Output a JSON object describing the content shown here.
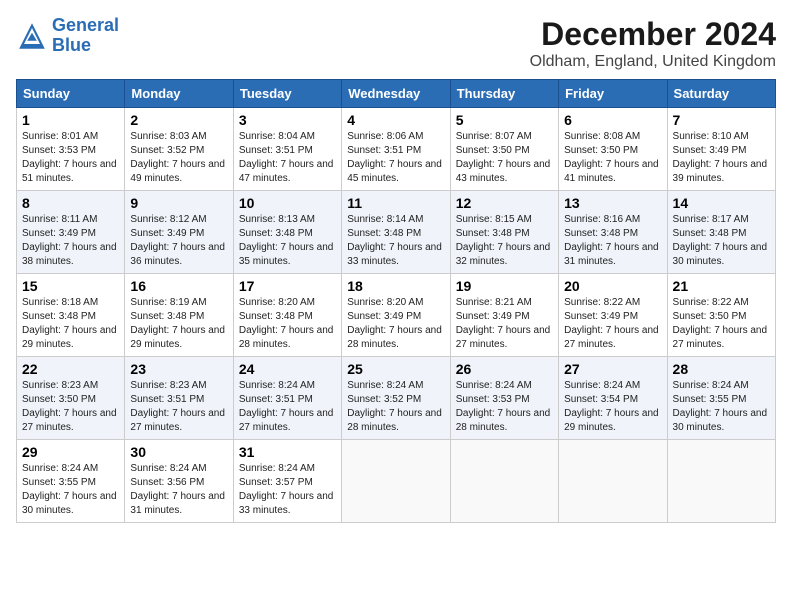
{
  "logo": {
    "line1": "General",
    "line2": "Blue"
  },
  "title": "December 2024",
  "subtitle": "Oldham, England, United Kingdom",
  "weekdays": [
    "Sunday",
    "Monday",
    "Tuesday",
    "Wednesday",
    "Thursday",
    "Friday",
    "Saturday"
  ],
  "weeks": [
    [
      {
        "day": "1",
        "sunrise": "8:01 AM",
        "sunset": "3:53 PM",
        "daylight": "7 hours and 51 minutes."
      },
      {
        "day": "2",
        "sunrise": "8:03 AM",
        "sunset": "3:52 PM",
        "daylight": "7 hours and 49 minutes."
      },
      {
        "day": "3",
        "sunrise": "8:04 AM",
        "sunset": "3:51 PM",
        "daylight": "7 hours and 47 minutes."
      },
      {
        "day": "4",
        "sunrise": "8:06 AM",
        "sunset": "3:51 PM",
        "daylight": "7 hours and 45 minutes."
      },
      {
        "day": "5",
        "sunrise": "8:07 AM",
        "sunset": "3:50 PM",
        "daylight": "7 hours and 43 minutes."
      },
      {
        "day": "6",
        "sunrise": "8:08 AM",
        "sunset": "3:50 PM",
        "daylight": "7 hours and 41 minutes."
      },
      {
        "day": "7",
        "sunrise": "8:10 AM",
        "sunset": "3:49 PM",
        "daylight": "7 hours and 39 minutes."
      }
    ],
    [
      {
        "day": "8",
        "sunrise": "8:11 AM",
        "sunset": "3:49 PM",
        "daylight": "7 hours and 38 minutes."
      },
      {
        "day": "9",
        "sunrise": "8:12 AM",
        "sunset": "3:49 PM",
        "daylight": "7 hours and 36 minutes."
      },
      {
        "day": "10",
        "sunrise": "8:13 AM",
        "sunset": "3:48 PM",
        "daylight": "7 hours and 35 minutes."
      },
      {
        "day": "11",
        "sunrise": "8:14 AM",
        "sunset": "3:48 PM",
        "daylight": "7 hours and 33 minutes."
      },
      {
        "day": "12",
        "sunrise": "8:15 AM",
        "sunset": "3:48 PM",
        "daylight": "7 hours and 32 minutes."
      },
      {
        "day": "13",
        "sunrise": "8:16 AM",
        "sunset": "3:48 PM",
        "daylight": "7 hours and 31 minutes."
      },
      {
        "day": "14",
        "sunrise": "8:17 AM",
        "sunset": "3:48 PM",
        "daylight": "7 hours and 30 minutes."
      }
    ],
    [
      {
        "day": "15",
        "sunrise": "8:18 AM",
        "sunset": "3:48 PM",
        "daylight": "7 hours and 29 minutes."
      },
      {
        "day": "16",
        "sunrise": "8:19 AM",
        "sunset": "3:48 PM",
        "daylight": "7 hours and 29 minutes."
      },
      {
        "day": "17",
        "sunrise": "8:20 AM",
        "sunset": "3:48 PM",
        "daylight": "7 hours and 28 minutes."
      },
      {
        "day": "18",
        "sunrise": "8:20 AM",
        "sunset": "3:49 PM",
        "daylight": "7 hours and 28 minutes."
      },
      {
        "day": "19",
        "sunrise": "8:21 AM",
        "sunset": "3:49 PM",
        "daylight": "7 hours and 27 minutes."
      },
      {
        "day": "20",
        "sunrise": "8:22 AM",
        "sunset": "3:49 PM",
        "daylight": "7 hours and 27 minutes."
      },
      {
        "day": "21",
        "sunrise": "8:22 AM",
        "sunset": "3:50 PM",
        "daylight": "7 hours and 27 minutes."
      }
    ],
    [
      {
        "day": "22",
        "sunrise": "8:23 AM",
        "sunset": "3:50 PM",
        "daylight": "7 hours and 27 minutes."
      },
      {
        "day": "23",
        "sunrise": "8:23 AM",
        "sunset": "3:51 PM",
        "daylight": "7 hours and 27 minutes."
      },
      {
        "day": "24",
        "sunrise": "8:24 AM",
        "sunset": "3:51 PM",
        "daylight": "7 hours and 27 minutes."
      },
      {
        "day": "25",
        "sunrise": "8:24 AM",
        "sunset": "3:52 PM",
        "daylight": "7 hours and 28 minutes."
      },
      {
        "day": "26",
        "sunrise": "8:24 AM",
        "sunset": "3:53 PM",
        "daylight": "7 hours and 28 minutes."
      },
      {
        "day": "27",
        "sunrise": "8:24 AM",
        "sunset": "3:54 PM",
        "daylight": "7 hours and 29 minutes."
      },
      {
        "day": "28",
        "sunrise": "8:24 AM",
        "sunset": "3:55 PM",
        "daylight": "7 hours and 30 minutes."
      }
    ],
    [
      {
        "day": "29",
        "sunrise": "8:24 AM",
        "sunset": "3:55 PM",
        "daylight": "7 hours and 30 minutes."
      },
      {
        "day": "30",
        "sunrise": "8:24 AM",
        "sunset": "3:56 PM",
        "daylight": "7 hours and 31 minutes."
      },
      {
        "day": "31",
        "sunrise": "8:24 AM",
        "sunset": "3:57 PM",
        "daylight": "7 hours and 33 minutes."
      },
      null,
      null,
      null,
      null
    ]
  ],
  "labels": {
    "sunrise": "Sunrise:",
    "sunset": "Sunset:",
    "daylight": "Daylight hours"
  }
}
